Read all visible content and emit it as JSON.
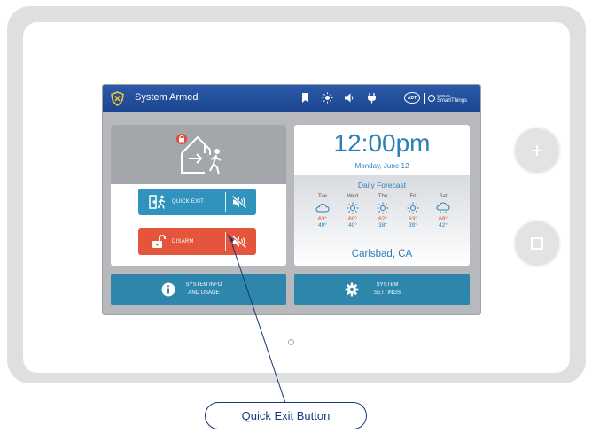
{
  "topbar": {
    "status": "System Armed",
    "icons": [
      "bookmark-icon",
      "brightness-icon",
      "speaker-icon",
      "plug-icon"
    ],
    "brand": {
      "adt": "ADT",
      "partner_small": "SAMSUNG",
      "partner": "SmartThings"
    }
  },
  "arm_panel": {
    "illustration": "house-exit-icon",
    "quick_exit_label": "QUICK EXIT",
    "disarm_label": "DISARM"
  },
  "clock": {
    "time": "12:00pm",
    "date": "Monday, June 12"
  },
  "forecast": {
    "title": "Daily Forecast",
    "days": [
      {
        "day": "Tue",
        "icon": "cloudy-icon",
        "hi": "63°",
        "lo": "49°"
      },
      {
        "day": "Wed",
        "icon": "sunny-icon",
        "hi": "60°",
        "lo": "40°"
      },
      {
        "day": "Thu",
        "icon": "sunny-icon",
        "hi": "62°",
        "lo": "38°"
      },
      {
        "day": "Fri",
        "icon": "sunny-icon",
        "hi": "63°",
        "lo": "39°"
      },
      {
        "day": "Sat",
        "icon": "rain-icon",
        "hi": "69°",
        "lo": "42°"
      }
    ],
    "city": "Carlsbad, CA"
  },
  "tiles": {
    "info_line1": "SYSTEM INFO",
    "info_line2": "AND USAGE",
    "settings_line1": "SYSTEM",
    "settings_line2": "SETTINGS"
  },
  "callout": {
    "label": "Quick Exit Button"
  },
  "colors": {
    "topbar": "#1c4590",
    "accent_blue": "#2f93bd",
    "disarm_red": "#e4553b",
    "text_blue": "#2c7fb6",
    "temp_red": "#d9472b"
  }
}
